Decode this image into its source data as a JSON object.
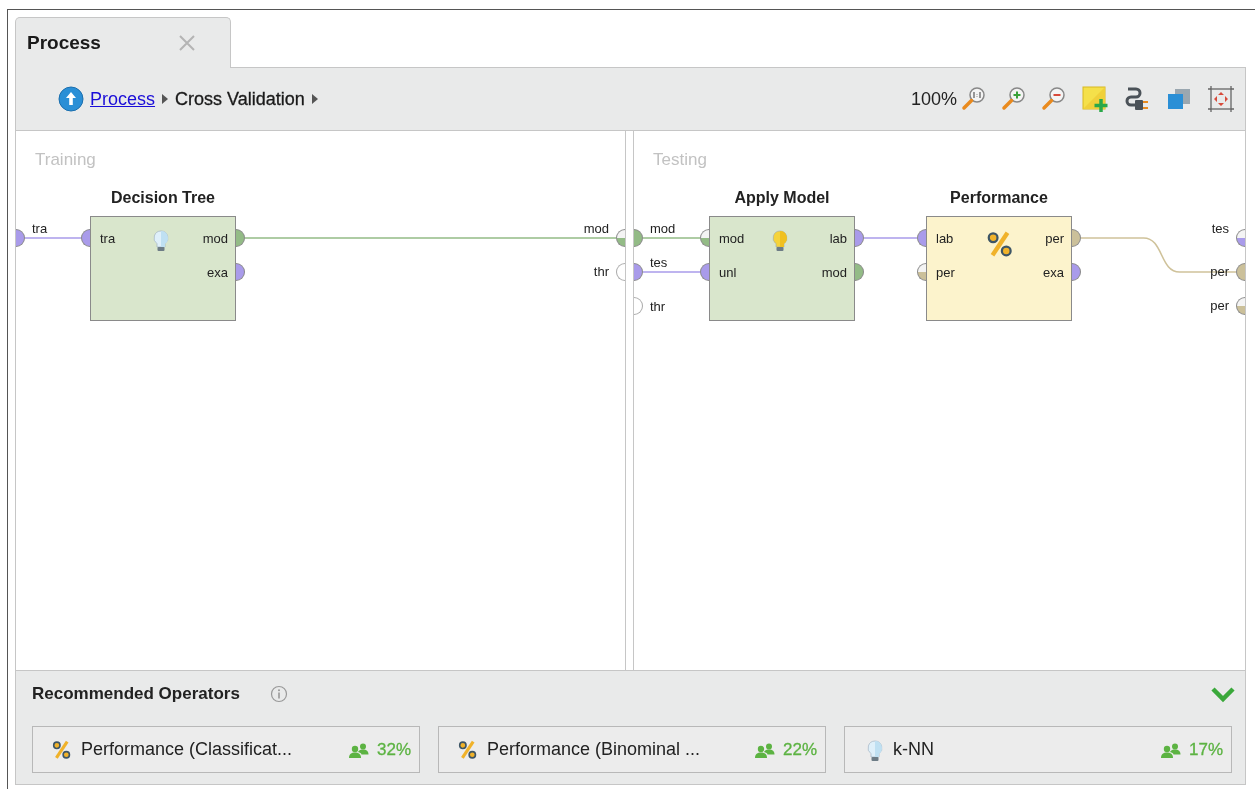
{
  "tabs": [
    {
      "label": "Process",
      "selected": true
    }
  ],
  "breadcrumb": [
    {
      "label": "Process",
      "link": true
    },
    {
      "label": "Cross Validation",
      "link": false
    }
  ],
  "toolbar": {
    "zoom": "100%"
  },
  "panels": [
    {
      "title": "Training",
      "inputs": [
        {
          "label": "tra",
          "kind": "example",
          "filled": true
        }
      ],
      "outputs": [
        {
          "label": "mod",
          "kind": "model",
          "filled": false
        },
        {
          "label": "thr",
          "kind": "threshold",
          "filled": false
        }
      ],
      "operators": [
        {
          "name": "Decision Tree",
          "kind": "learner",
          "in": [
            {
              "label": "tra",
              "kind": "example",
              "filled": true
            }
          ],
          "out": [
            {
              "label": "mod",
              "kind": "model",
              "filled": true
            },
            {
              "label": "exa",
              "kind": "example",
              "filled": true
            }
          ]
        }
      ]
    },
    {
      "title": "Testing",
      "inputs": [
        {
          "label": "mod",
          "kind": "model",
          "filled": true
        },
        {
          "label": "tes",
          "kind": "example",
          "filled": true
        },
        {
          "label": "thr",
          "kind": "threshold",
          "filled": false
        }
      ],
      "outputs": [
        {
          "label": "tes",
          "kind": "example",
          "filled": false
        },
        {
          "label": "per",
          "kind": "performance",
          "filled": true
        },
        {
          "label": "per",
          "kind": "performance",
          "filled": false
        }
      ],
      "operators": [
        {
          "name": "Apply Model",
          "kind": "applier",
          "in": [
            {
              "label": "mod",
              "kind": "model",
              "filled": false
            },
            {
              "label": "unl",
              "kind": "example",
              "filled": true
            }
          ],
          "out": [
            {
              "label": "lab",
              "kind": "example",
              "filled": true
            },
            {
              "label": "mod",
              "kind": "model",
              "filled": true
            }
          ]
        },
        {
          "name": "Performance",
          "kind": "performance",
          "in": [
            {
              "label": "lab",
              "kind": "example",
              "filled": true
            },
            {
              "label": "per",
              "kind": "performance",
              "filled": false
            }
          ],
          "out": [
            {
              "label": "per",
              "kind": "performance",
              "filled": true
            },
            {
              "label": "exa",
              "kind": "example",
              "filled": true
            }
          ]
        }
      ]
    }
  ],
  "recommended": {
    "title": "Recommended Operators",
    "items": [
      {
        "name": "Performance (Classificat...",
        "kind": "performance",
        "share": "32%"
      },
      {
        "name": "Performance (Binominal ...",
        "kind": "performance",
        "share": "22%"
      },
      {
        "name": "k-NN",
        "kind": "learner",
        "share": "17%"
      }
    ]
  }
}
